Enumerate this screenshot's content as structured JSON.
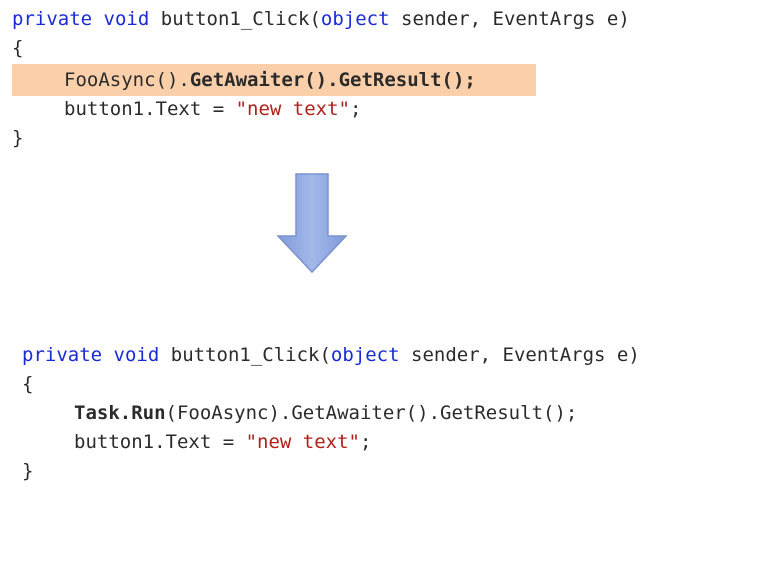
{
  "before": {
    "signature": {
      "kw_private": "private",
      "kw_void": "void",
      "method": "button1_Click(",
      "kw_object": "object",
      "params": "sender, EventArgs e)"
    },
    "open_brace": "{",
    "line1": {
      "call": "FooAsync().",
      "awaiter": "GetAwaiter().",
      "result": "GetResult();"
    },
    "line2": {
      "assign": "button1.Text = ",
      "string": "\"new text\"",
      "end": ";"
    },
    "close_brace": "}"
  },
  "after": {
    "signature": {
      "kw_private": "private",
      "kw_void": "void",
      "method": "button1_Click(",
      "kw_object": "object",
      "params": "sender, EventArgs e)"
    },
    "open_brace": "{",
    "line1": {
      "task_run": "Task.Run",
      "rest": "(FooAsync).GetAwaiter().GetResult();"
    },
    "line2": {
      "assign": "button1.Text = ",
      "string": "\"new text\"",
      "end": ";"
    },
    "close_brace": "}"
  },
  "colors": {
    "keyword": "#1a2bd6",
    "string": "#b0201a",
    "highlight": "#f9c79a",
    "arrow": "#8fa8e0"
  },
  "icons": {
    "arrow": "down-arrow-icon"
  }
}
